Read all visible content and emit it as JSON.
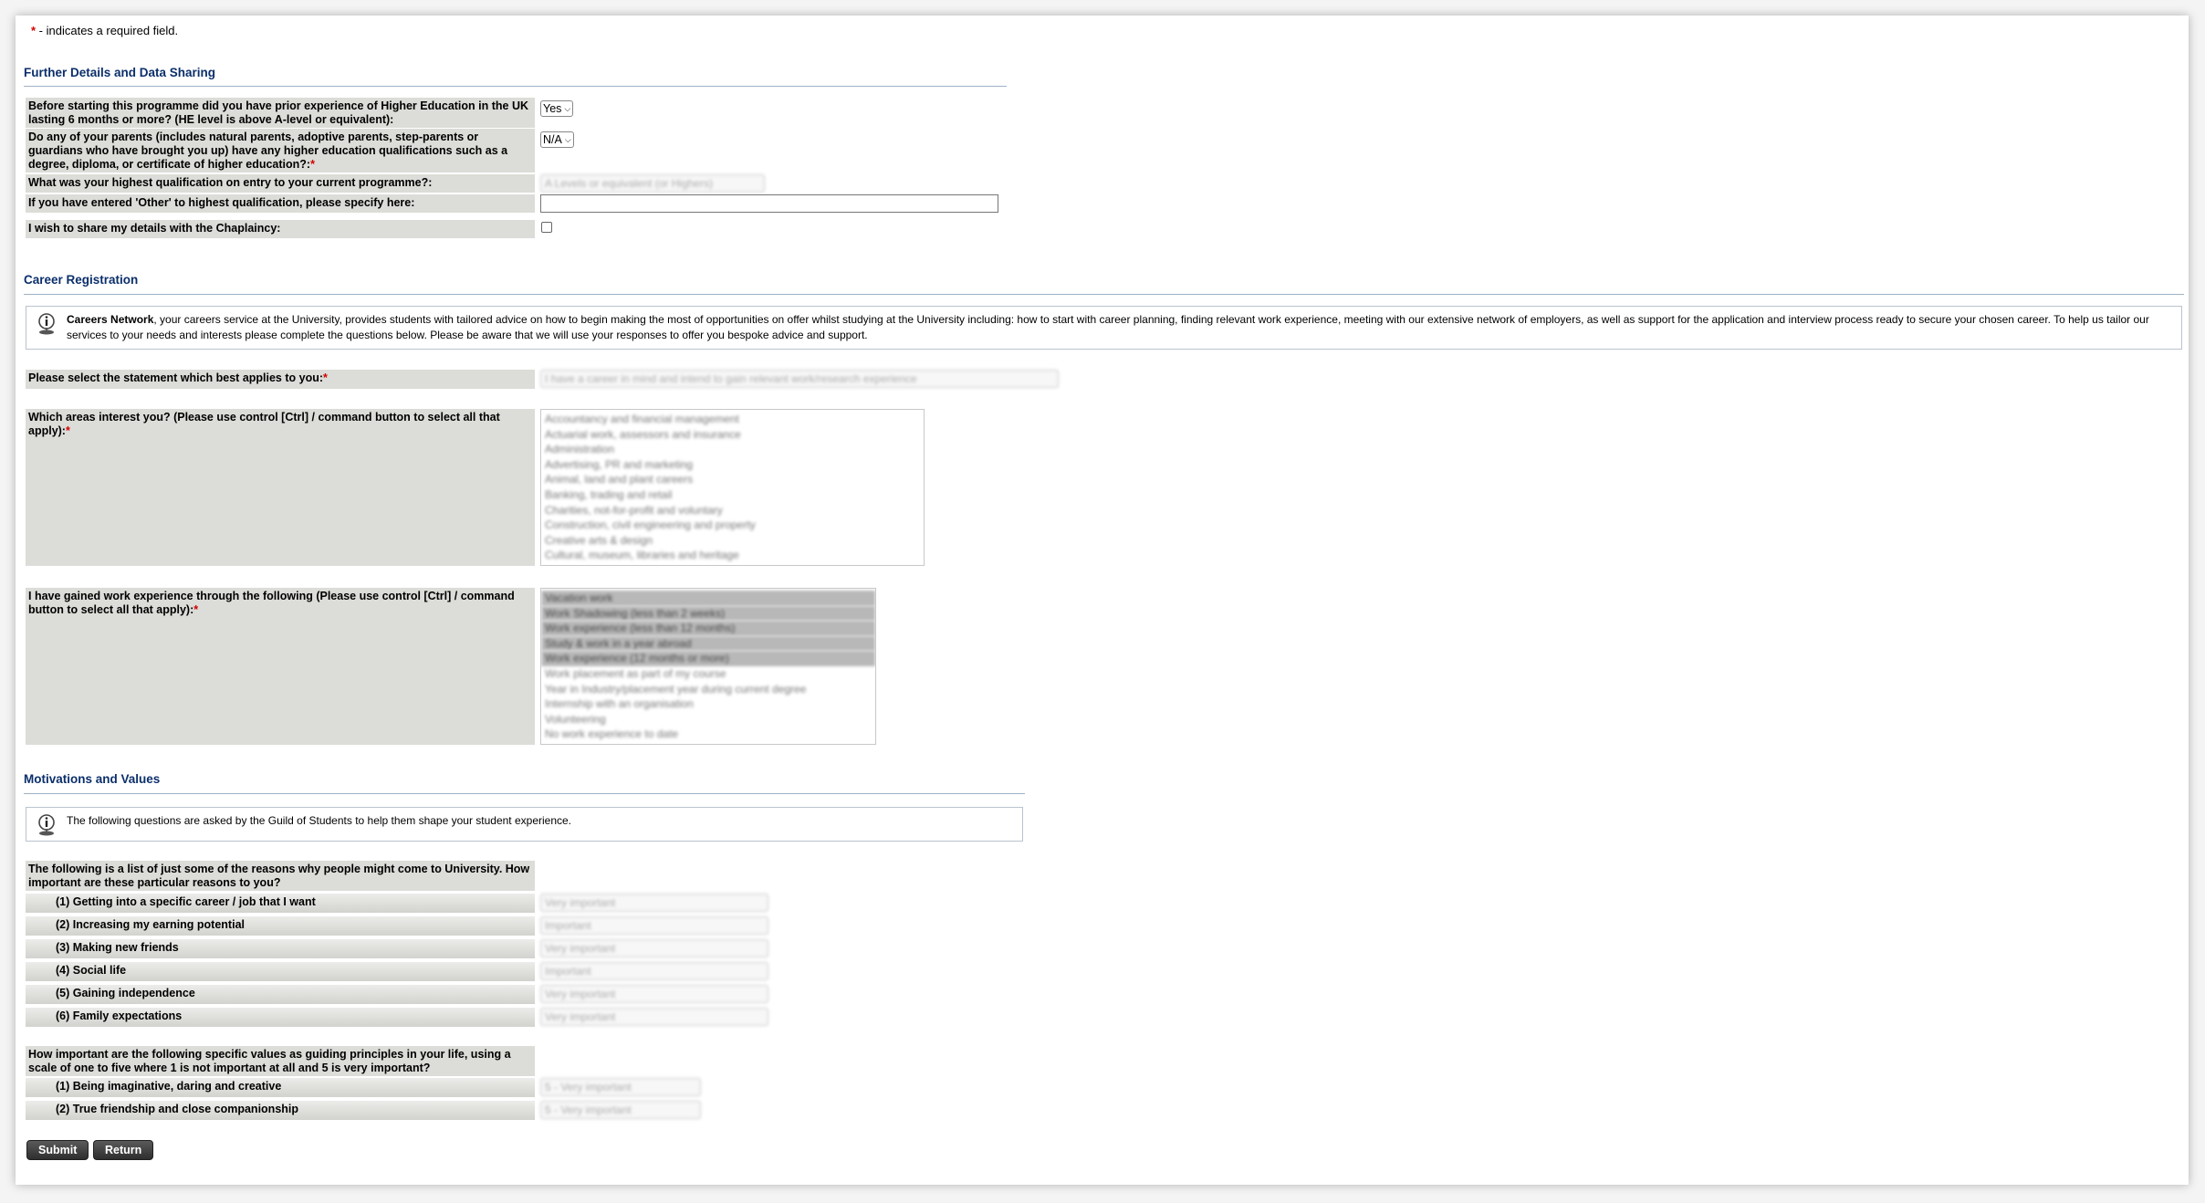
{
  "required_note": {
    "star": "*",
    "text": " - indicates a required field."
  },
  "sections": {
    "further": {
      "title": "Further Details and Data Sharing"
    },
    "career": {
      "title": "Career Registration"
    },
    "motivations": {
      "title": "Motivations and Values"
    }
  },
  "further_rows": {
    "prior_he": {
      "label": "Before starting this programme did you have prior experience of Higher Education in the UK lasting 6 months or more? (HE level is above A-level or equivalent):",
      "value": "Yes"
    },
    "parents_he": {
      "label": "Do any of your parents (includes natural parents, adoptive parents, step-parents or guardians who have brought you up) have any higher education qualifications such as a degree, diploma, or certificate of higher education?:",
      "value": "N/A"
    },
    "highest_qual": {
      "label": "What was your highest qualification on entry to your current programme?:",
      "value": "A Levels or equivalent (or Highers)"
    },
    "other_qual": {
      "label": "If you have entered 'Other' to highest qualification, please specify here:",
      "value": ""
    },
    "chaplaincy": {
      "label": "I wish to share my details with the Chaplaincy:"
    }
  },
  "career_info": {
    "bold": "Careers Network",
    "text": ", your careers service at the University, provides students with tailored advice on how to begin making the most of opportunities on offer whilst studying at the University including: how to start with career planning, finding relevant work experience, meeting with our extensive network of employers, as well as support for the application and interview process ready to secure your chosen career. To help us tailor our services to your needs and interests please complete the questions below. Please be aware that we will use your responses to offer you bespoke advice and support."
  },
  "career_rows": {
    "statement": {
      "label": "Please select the statement which best applies to you:",
      "value": "I have a career in mind and intend to gain relevant work/research experience"
    },
    "areas": {
      "label": "Which areas interest you? (Please use control [Ctrl] / command button to select all that apply):",
      "options": [
        "Accountancy and financial management",
        "Actuarial work, assessors and insurance",
        "Administration",
        "Advertising, PR and marketing",
        "Animal, land and plant careers",
        "Banking, trading and retail",
        "Charities, not-for-profit and voluntary",
        "Construction, civil engineering and property",
        "Creative arts & design",
        "Cultural, museum, libraries and heritage"
      ]
    },
    "work_exp": {
      "label": "I have gained work experience through the following (Please use control [Ctrl] / command button to select all that apply):",
      "options": [
        "Vacation work",
        "Work Shadowing (less than 2 weeks)",
        "Work experience (less than 12 months)",
        "Study & work in a year abroad",
        "Work experience (12 months or more)",
        "Work placement as part of my course",
        "Year in Industry/placement year during current degree",
        "Internship with an organisation",
        "Volunteering",
        "No work experience to date"
      ],
      "selected_count": 5
    }
  },
  "motivations_info": {
    "text": "The following questions are asked by the Guild of Students to help them shape your student experience."
  },
  "reasons": {
    "header": "The following is a list of just some of the reasons why people might come to University. How important are these particular reasons to you?",
    "items": [
      {
        "label": "(1) Getting into a specific career / job that I want",
        "value": "Very important"
      },
      {
        "label": "(2) Increasing my earning potential",
        "value": "Important"
      },
      {
        "label": "(3) Making new friends",
        "value": "Very important"
      },
      {
        "label": "(4) Social life",
        "value": "Important"
      },
      {
        "label": "(5) Gaining independence",
        "value": "Very important"
      },
      {
        "label": "(6) Family expectations",
        "value": "Very important"
      }
    ]
  },
  "values": {
    "header": "How important are the following specific values as guiding principles in your life, using a scale of one to five where 1 is not important at all and 5 is very important?",
    "items": [
      {
        "label": "(1) Being imaginative, daring and creative",
        "value": "5 - Very important"
      },
      {
        "label": "(2) True friendship and close companionship",
        "value": "5 - Very important"
      }
    ]
  },
  "buttons": {
    "submit": "Submit",
    "return": "Return"
  }
}
